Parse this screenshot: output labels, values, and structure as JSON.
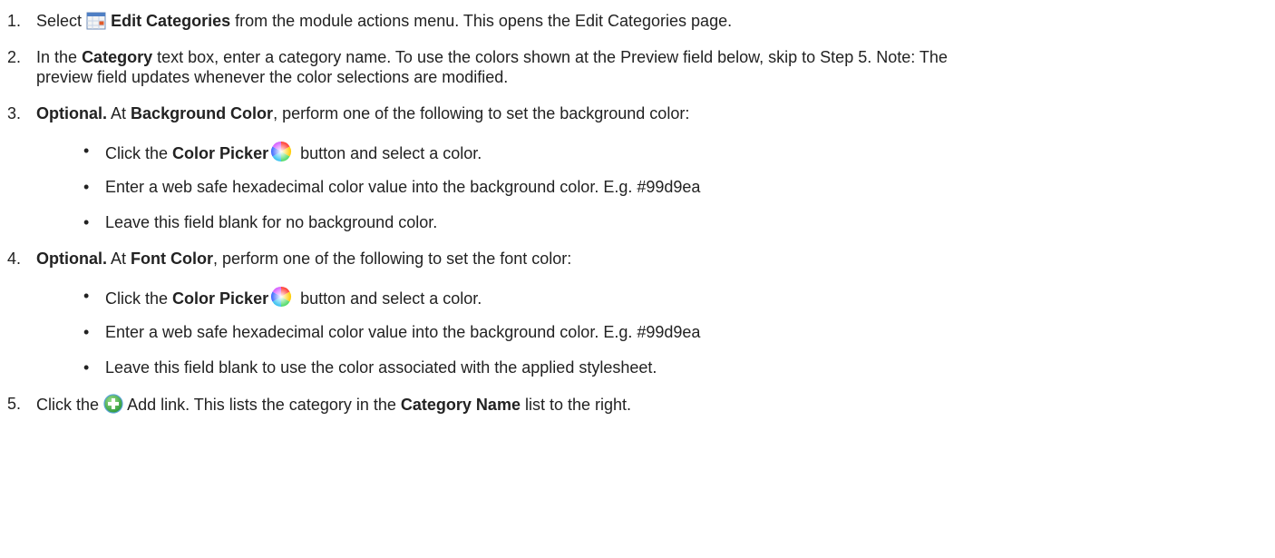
{
  "steps": [
    {
      "number": "1.",
      "pre": "Select",
      "icon": "calendar-categories-icon",
      "bold": "Edit Categories",
      "post": "from the module actions menu. This opens the Edit Categories page."
    },
    {
      "number": "2.",
      "pre": "In the",
      "bold": "Category",
      "post": "text box, enter a category name. To use the colors shown at the Preview field below, skip to Step 5. Note: The",
      "line2": "preview field updates whenever the color selections are modified."
    },
    {
      "number": "3.",
      "optional": "Optional.",
      "at": "At",
      "bold": "Background Color",
      "post": ", perform one of the following to set the background color:",
      "bullets": [
        {
          "pre": "Click the",
          "bold": "Color Picker",
          "icon": "color-wheel-icon",
          "post": "button and select a color."
        },
        {
          "text": "Enter a web safe hexadecimal color value into the background color. E.g. #99d9ea"
        },
        {
          "text": "Leave this field blank for no background color."
        }
      ]
    },
    {
      "number": "4.",
      "optional": "Optional.",
      "at": "At",
      "bold": "Font Color",
      "post": ", perform one of the following to set the font color:",
      "bullets": [
        {
          "pre": "Click the",
          "bold": "Color Picker",
          "icon": "color-wheel-icon",
          "post": "button and select a color."
        },
        {
          "text": "Enter a web safe hexadecimal color value into the background color. E.g. #99d9ea"
        },
        {
          "text": "Leave this field blank to use the color associated with the applied stylesheet."
        }
      ]
    },
    {
      "number": "5.",
      "pre": "Click the",
      "icon": "add-plus-icon",
      "mid": "Add link. This lists the category in the",
      "bold": "Category Name",
      "post": "list to the right."
    }
  ],
  "bullet_char": "•"
}
